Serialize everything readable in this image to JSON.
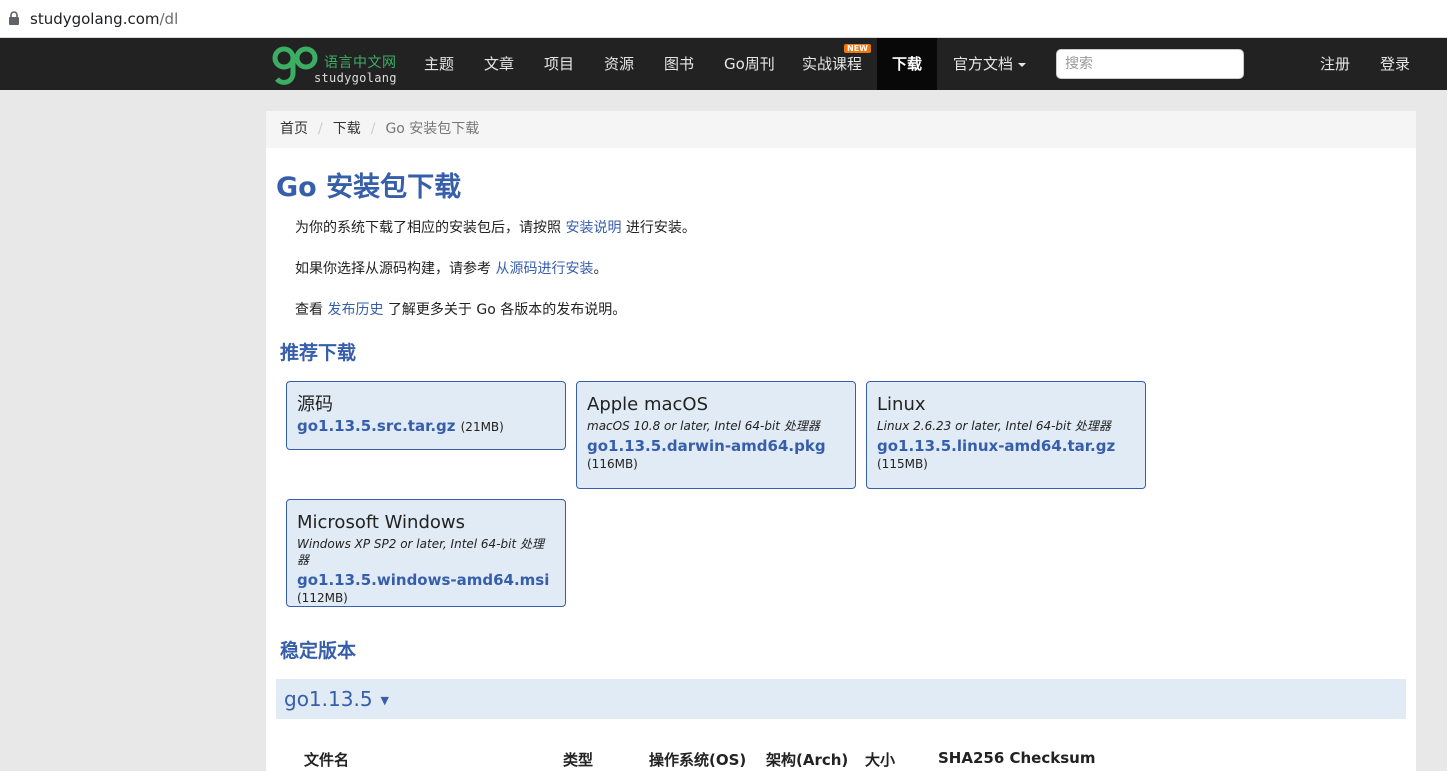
{
  "address_bar": {
    "domain": "studygolang.com",
    "path": "/dl"
  },
  "logo": {
    "cn": "语言中文网",
    "en": "studygolang"
  },
  "nav": {
    "items": [
      "主题",
      "文章",
      "项目",
      "资源",
      "图书",
      "Go周刊",
      "实战课程"
    ],
    "new_badge": "NEW",
    "active": "下载",
    "docs": "官方文档",
    "search_placeholder": "搜索",
    "register": "注册",
    "login": "登录"
  },
  "breadcrumb": {
    "home": "首页",
    "download": "下载",
    "current": "Go 安装包下载"
  },
  "page_title": "Go 安装包下载",
  "intro": {
    "p1_before": "为你的系统下载了相应的安装包后，请按照 ",
    "p1_link": "安装说明",
    "p1_after": " 进行安装。",
    "p2_before": "如果你选择从源码构建，请参考 ",
    "p2_link": "从源码进行安装",
    "p2_after": "。",
    "p3_before": "查看 ",
    "p3_link": "发布历史",
    "p3_after": " 了解更多关于 Go 各版本的发布说明。"
  },
  "featured_heading": "推荐下载",
  "featured": [
    {
      "os": "源码",
      "desc": "",
      "file": "go1.13.5.src.tar.gz",
      "size": "(21MB)"
    },
    {
      "os": "Apple macOS",
      "desc": "macOS 10.8 or later, Intel 64-bit 处理器",
      "file": "go1.13.5.darwin-amd64.pkg",
      "size": "(116MB)"
    },
    {
      "os": "Linux",
      "desc": "Linux 2.6.23 or later, Intel 64-bit 处理器",
      "file": "go1.13.5.linux-amd64.tar.gz",
      "size": "(115MB)"
    },
    {
      "os": "Microsoft Windows",
      "desc": "Windows XP SP2 or later, Intel 64-bit 处理器",
      "file": "go1.13.5.windows-amd64.msi",
      "size": "(112MB)"
    }
  ],
  "stable_heading": "稳定版本",
  "stable_version": "go1.13.5",
  "table_headers": [
    "文件名",
    "类型",
    "操作系统(OS)",
    "架构(Arch)",
    "大小",
    "SHA256 Checksum"
  ],
  "colors": {
    "brand_blue": "#375eab",
    "card_bg": "#e0ebf5",
    "navbar": "#222222",
    "logo_green": "#3cae64",
    "badge": "#f0760e"
  }
}
